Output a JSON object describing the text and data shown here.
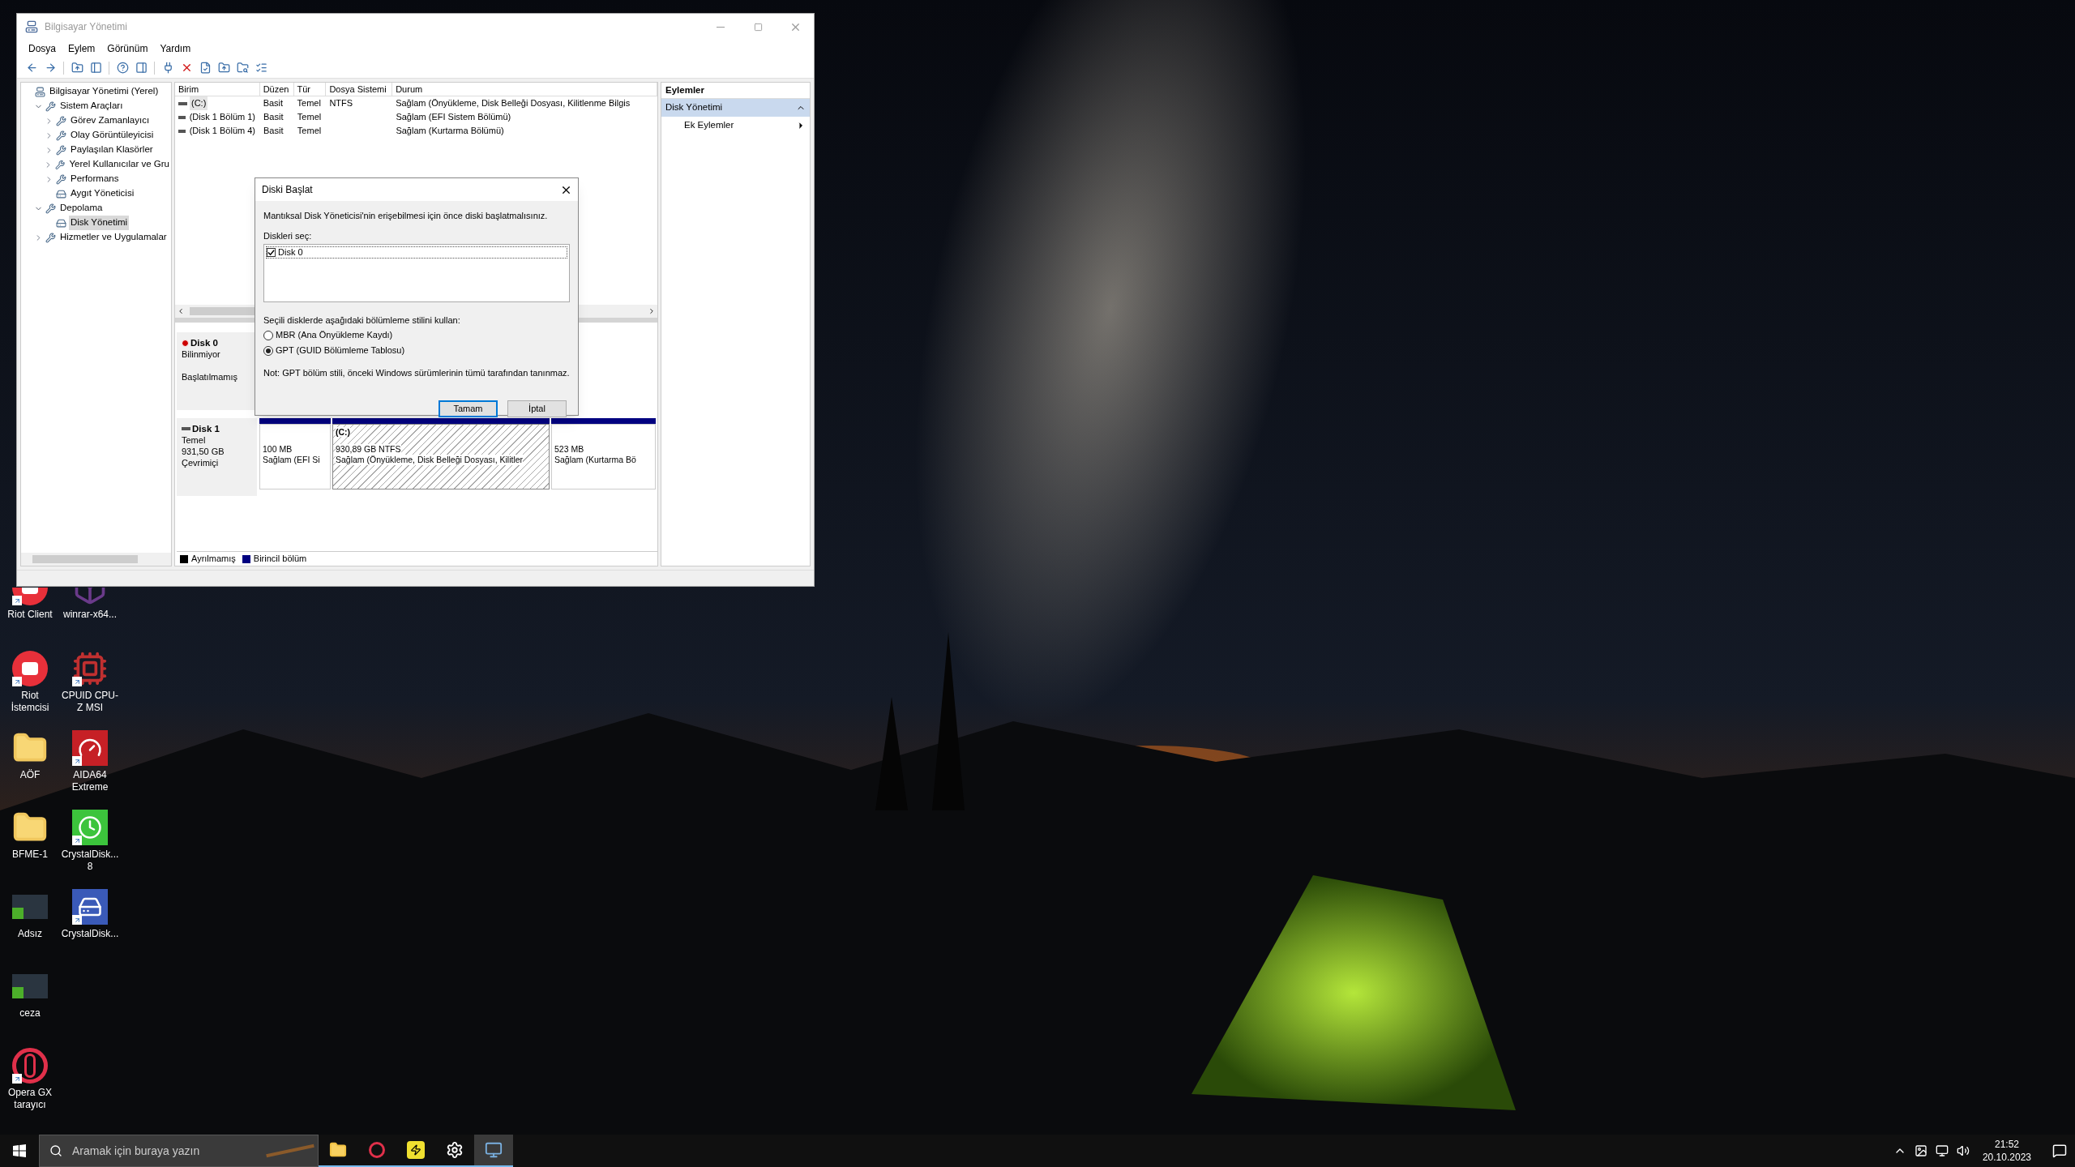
{
  "window": {
    "title": "Bilgisayar Yönetimi",
    "menu": [
      "Dosya",
      "Eylem",
      "Görünüm",
      "Yardım"
    ]
  },
  "tree": [
    {
      "label": "Bilgisayar Yönetimi (Yerel)",
      "kind": "root",
      "selected": false,
      "children": [
        {
          "label": "Sistem Araçları",
          "kind": "branch",
          "expanded": true,
          "selected": false,
          "children": [
            {
              "label": "Görev Zamanlayıcı",
              "kind": "branch",
              "expanded": false,
              "selected": false
            },
            {
              "label": "Olay Görüntüleyicisi",
              "kind": "branch",
              "expanded": false,
              "selected": false
            },
            {
              "label": "Paylaşılan Klasörler",
              "kind": "branch",
              "expanded": false,
              "selected": false
            },
            {
              "label": "Yerel Kullanıcılar ve Gru",
              "kind": "branch",
              "expanded": false,
              "selected": false
            },
            {
              "label": "Performans",
              "kind": "branch",
              "expanded": false,
              "selected": false
            },
            {
              "label": "Aygıt Yöneticisi",
              "kind": "leaf",
              "selected": false
            }
          ]
        },
        {
          "label": "Depolama",
          "kind": "branch",
          "expanded": true,
          "selected": false,
          "children": [
            {
              "label": "Disk Yönetimi",
              "kind": "leaf",
              "selected": true
            }
          ]
        },
        {
          "label": "Hizmetler ve Uygulamalar",
          "kind": "branch",
          "expanded": false,
          "selected": false
        }
      ]
    }
  ],
  "volumes": {
    "columns": [
      "Birim",
      "Düzen",
      "Tür",
      "Dosya Sistemi",
      "Durum"
    ],
    "rows": [
      {
        "selected": true,
        "cells": [
          "(C:)",
          "Basit",
          "Temel",
          "NTFS",
          "Sağlam (Önyükleme, Disk Belleği Dosyası, Kilitlenme Bilgis"
        ]
      },
      {
        "selected": false,
        "cells": [
          "(Disk 1 Bölüm 1)",
          "Basit",
          "Temel",
          "",
          "Sağlam (EFI Sistem Bölümü)"
        ]
      },
      {
        "selected": false,
        "cells": [
          "(Disk 1 Bölüm 4)",
          "Basit",
          "Temel",
          "",
          "Sağlam (Kurtarma Bölümü)"
        ]
      }
    ]
  },
  "disks": [
    {
      "name": "Disk 0",
      "kind": "error",
      "type": "Bilinmiyor",
      "status": "Başlatılmamış"
    },
    {
      "name": "Disk 1",
      "kind": "ok",
      "type": "Temel",
      "size": "931,50 GB",
      "status": "Çevrimiçi",
      "partitions": [
        {
          "size": "100 MB",
          "status": "Sağlam (EFI Si",
          "selected": false
        },
        {
          "label": "(C:)",
          "size": "930,89 GB NTFS",
          "status": "Sağlam (Önyükleme, Disk Belleği Dosyası, Kilitler",
          "selected": true
        },
        {
          "size": "523 MB",
          "status": "Sağlam (Kurtarma Bö",
          "selected": false
        }
      ]
    }
  ],
  "legend": [
    {
      "label": "Ayrılmamış",
      "color": "#000000"
    },
    {
      "label": "Birincil bölüm",
      "color": "#000080"
    }
  ],
  "actions": {
    "title": "Eylemler",
    "section": "Disk Yönetimi",
    "items": [
      "Ek Eylemler"
    ]
  },
  "dialog": {
    "title": "Diski Başlat",
    "message": "Mantıksal Disk Yöneticisi'nin erişebilmesi için önce diski başlatmalısınız.",
    "list_label": "Diskleri seç:",
    "disks": [
      {
        "label": "Disk 0",
        "checked": true
      }
    ],
    "style_label": "Seçili disklerde aşağıdaki bölümleme stilini kullan:",
    "options": [
      {
        "label": "MBR (Ana Önyükleme Kaydı)",
        "selected": false
      },
      {
        "label": "GPT (GUID Bölümleme Tablosu)",
        "selected": true
      }
    ],
    "note": "Not: GPT bölüm stili, önceki Windows sürümlerinin tümü tarafından tanınmaz.",
    "buttons": [
      {
        "label": "Tamam",
        "default": true
      },
      {
        "label": "İptal",
        "default": false
      }
    ]
  },
  "desktop_columns": [
    [
      {
        "label": "Riot Client",
        "kind": "riot",
        "shortcut": true
      },
      {
        "label": "Riot İstemcisi",
        "kind": "riot",
        "shortcut": true
      },
      {
        "label": "AÖF",
        "kind": "folder",
        "shortcut": false
      },
      {
        "label": "BFME-1",
        "kind": "folder",
        "shortcut": false
      },
      {
        "label": "Adsız",
        "kind": "image",
        "shortcut": false
      },
      {
        "label": "ceza",
        "kind": "image",
        "shortcut": false
      },
      {
        "label": "Opera GX tarayıcı",
        "kind": "opera",
        "shortcut": true
      }
    ],
    [
      {
        "label": "winrar-x64...",
        "kind": "archive",
        "shortcut": false
      },
      {
        "label": "CPUID CPU-Z MSI",
        "kind": "chip",
        "shortcut": true
      },
      {
        "label": "AIDA64 Extreme",
        "kind": "aida",
        "shortcut": true
      },
      {
        "label": "CrystalDisk... 8",
        "kind": "stopwatch",
        "shortcut": true
      },
      {
        "label": "CrystalDisk...",
        "kind": "disk",
        "shortcut": true
      }
    ]
  ],
  "taskbar": {
    "search_placeholder": "Aramak için buraya yazın",
    "apps": [
      {
        "kind": "folder",
        "active": false
      },
      {
        "kind": "opera",
        "active": false
      },
      {
        "kind": "bolt",
        "active": false
      },
      {
        "kind": "gear",
        "active": false
      },
      {
        "kind": "computer",
        "active": true
      }
    ],
    "time": "21:52",
    "date": "20.10.2023"
  }
}
